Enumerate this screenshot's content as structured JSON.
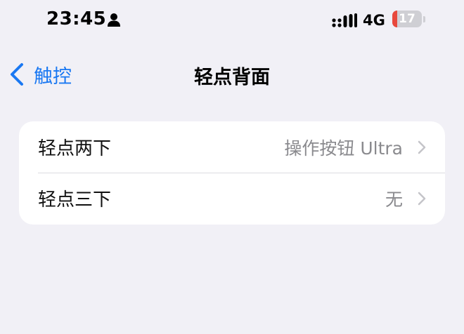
{
  "status_bar": {
    "time": "23:45",
    "network": "4G",
    "battery_level": "17",
    "battery_fraction": 0.17,
    "icons": [
      "person-icon",
      "cellular-signal-icon",
      "battery-icon"
    ]
  },
  "nav": {
    "back_label": "触控",
    "title": "轻点背面",
    "accent_color": "#1a78f2"
  },
  "rows": [
    {
      "label": "轻点两下",
      "value": "操作按钮 Ultra"
    },
    {
      "label": "轻点三下",
      "value": "无"
    }
  ]
}
